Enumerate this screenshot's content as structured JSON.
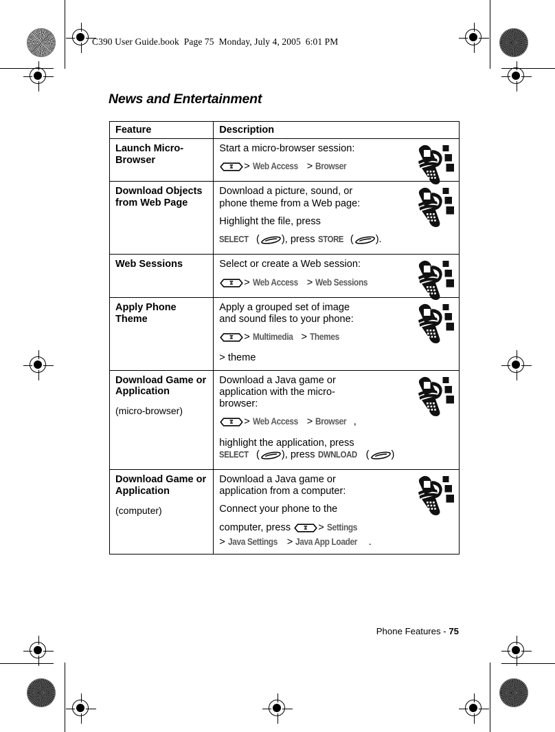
{
  "running_head": "C390 User Guide.book  Page 75  Monday, July 4, 2005  6:01 PM",
  "page_title": "News and Entertainment",
  "table": {
    "headers": {
      "feature": "Feature",
      "description": "Description"
    },
    "rows": [
      {
        "feature": "Launch Micro-Browser",
        "feature_sub": "",
        "lines": [
          {
            "parts": [
              {
                "t": "text",
                "v": "Start a micro-browser session:"
              }
            ]
          },
          {
            "parts": [
              {
                "t": "menukey"
              },
              {
                "t": "gt",
                "v": ">"
              },
              {
                "t": "mpath",
                "v": "Web Access"
              },
              {
                "t": "gt",
                "v": ">"
              },
              {
                "t": "mpath",
                "v": "Browser"
              }
            ]
          }
        ],
        "icon": "phone-download-icon"
      },
      {
        "feature": "Download Objects from Web Page",
        "feature_sub": "",
        "lines": [
          {
            "parts": [
              {
                "t": "text",
                "v": "Download a picture, sound, or"
              }
            ],
            "tight": true
          },
          {
            "parts": [
              {
                "t": "text",
                "v": "phone theme from a Web page:"
              }
            ],
            "tight": true
          },
          {
            "parts": [
              {
                "t": "text",
                "v": "Highlight the file, press"
              }
            ]
          },
          {
            "parts": [
              {
                "t": "soft",
                "v": "SELECT"
              },
              {
                "t": "text",
                "v": " ("
              },
              {
                "t": "softkey"
              },
              {
                "t": "text",
                "v": "), press "
              },
              {
                "t": "soft",
                "v": "STORE"
              },
              {
                "t": "text",
                "v": " ("
              },
              {
                "t": "softkey"
              },
              {
                "t": "text",
                "v": ")."
              }
            ],
            "tight": true
          }
        ],
        "icon": "phone-download-icon"
      },
      {
        "feature": "Web Sessions",
        "feature_sub": "",
        "lines": [
          {
            "parts": [
              {
                "t": "text",
                "v": "Select or create a Web session:"
              }
            ]
          },
          {
            "parts": [
              {
                "t": "menukey"
              },
              {
                "t": "gt",
                "v": ">"
              },
              {
                "t": "mpath",
                "v": "Web Access"
              },
              {
                "t": "gt",
                "v": ">"
              },
              {
                "t": "mpath",
                "v": "Web Sessions"
              }
            ]
          }
        ],
        "icon": "phone-download-icon"
      },
      {
        "feature": "Apply Phone Theme",
        "feature_sub": "",
        "lines": [
          {
            "parts": [
              {
                "t": "text",
                "v": "Apply a grouped set of image"
              }
            ],
            "tight": true
          },
          {
            "parts": [
              {
                "t": "text",
                "v": "and sound files to your phone:"
              }
            ],
            "tight": true
          },
          {
            "parts": [
              {
                "t": "menukey"
              },
              {
                "t": "gt",
                "v": ">"
              },
              {
                "t": "mpath",
                "v": "Multimedia"
              },
              {
                "t": "gt",
                "v": ">"
              },
              {
                "t": "mpath",
                "v": "Themes"
              }
            ]
          },
          {
            "parts": [
              {
                "t": "gt",
                "v": ">"
              },
              {
                "t": "text",
                "v": " theme"
              }
            ],
            "tight": true
          }
        ],
        "icon": "phone-download-icon"
      },
      {
        "feature": "Download Game or Application",
        "feature_sub": "(micro-browser)",
        "lines": [
          {
            "parts": [
              {
                "t": "text",
                "v": "Download a Java game or"
              }
            ],
            "tight": true
          },
          {
            "parts": [
              {
                "t": "text",
                "v": "application with the micro-"
              }
            ],
            "tight": true
          },
          {
            "parts": [
              {
                "t": "text",
                "v": "browser:"
              }
            ],
            "tight": true
          },
          {
            "parts": [
              {
                "t": "menukey"
              },
              {
                "t": "gt",
                "v": ">"
              },
              {
                "t": "mpath",
                "v": "Web Access"
              },
              {
                "t": "gt",
                "v": ">"
              },
              {
                "t": "mpath",
                "v": "Browser"
              },
              {
                "t": "text",
                "v": ","
              }
            ]
          },
          {
            "parts": [
              {
                "t": "text",
                "v": "highlight the application, press"
              }
            ],
            "tight": true
          },
          {
            "parts": [
              {
                "t": "soft",
                "v": "SELECT"
              },
              {
                "t": "text",
                "v": " ("
              },
              {
                "t": "softkey"
              },
              {
                "t": "text",
                "v": "), press "
              },
              {
                "t": "soft",
                "v": "DWNLOAD"
              },
              {
                "t": "text",
                "v": " ("
              },
              {
                "t": "softkey"
              },
              {
                "t": "text",
                "v": ")"
              }
            ],
            "tight": true
          }
        ],
        "icon": "phone-download-icon"
      },
      {
        "feature": "Download Game or Application",
        "feature_sub": "(computer)",
        "lines": [
          {
            "parts": [
              {
                "t": "text",
                "v": "Download a Java game or"
              }
            ],
            "tight": true
          },
          {
            "parts": [
              {
                "t": "text",
                "v": "application from a computer:"
              }
            ],
            "tight": true
          },
          {
            "parts": [
              {
                "t": "text",
                "v": "Connect your phone to the"
              }
            ]
          },
          {
            "parts": [
              {
                "t": "text",
                "v": "computer, press "
              },
              {
                "t": "menukey"
              },
              {
                "t": "gt",
                "v": ">"
              },
              {
                "t": "mpath",
                "v": "Settings"
              }
            ],
            "tight": true
          },
          {
            "parts": [
              {
                "t": "gt",
                "v": ">"
              },
              {
                "t": "mpath",
                "v": "Java Settings"
              },
              {
                "t": "gt",
                "v": ">"
              },
              {
                "t": "mpath",
                "v": "Java App Loader"
              },
              {
                "t": "text",
                "v": "."
              }
            ],
            "tight": true
          }
        ],
        "icon": "phone-download-icon"
      }
    ]
  },
  "footer": {
    "label": "Phone Features - ",
    "page_number": "75"
  },
  "colors": {
    "menu_path": "#5b5b5b",
    "soft_label": "#4a4a4a",
    "rule": "#000000"
  }
}
